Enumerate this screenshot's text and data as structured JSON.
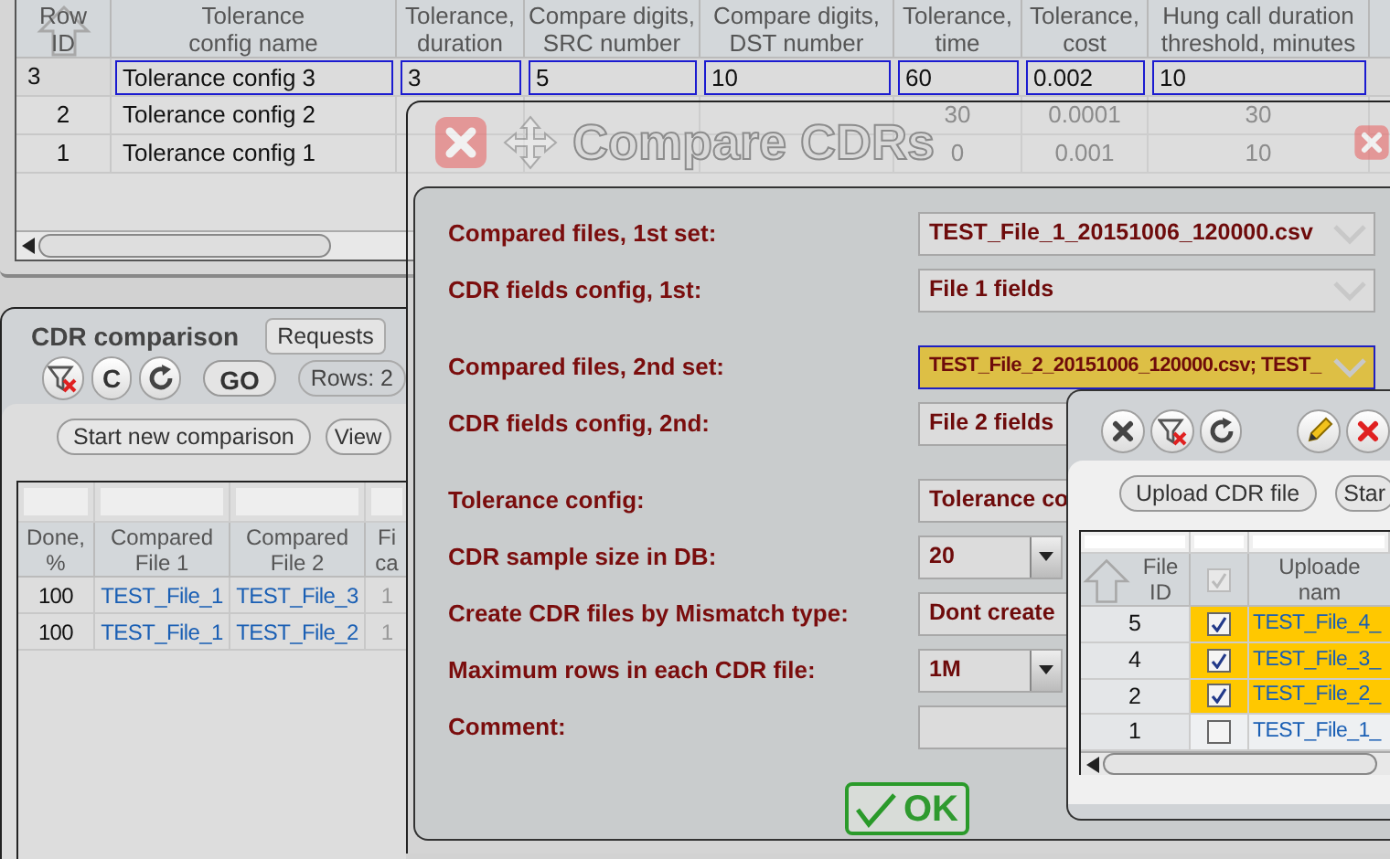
{
  "config_grid": {
    "columns": [
      {
        "label": "Row\nID",
        "sorted": true
      },
      {
        "label": "Tolerance\nconfig name",
        "sorted": false
      },
      {
        "label": "Tolerance,\nduration",
        "sorted": false
      },
      {
        "label": "Compare digits,\nSRC number",
        "sorted": false
      },
      {
        "label": "Compare digits,\nDST number",
        "sorted": false
      },
      {
        "label": "Tolerance,\ntime",
        "sorted": false
      },
      {
        "label": "Tolerance,\ncost",
        "sorted": false
      },
      {
        "label": "Hung call duration\nthreshold, minutes",
        "sorted": false
      }
    ],
    "rows": [
      {
        "selected": true,
        "row_id": "3",
        "name": "Tolerance config 3",
        "duration": "3",
        "src": "5",
        "dst": "10",
        "time": "60",
        "cost": "0.002",
        "hung": "10"
      },
      {
        "selected": false,
        "row_id": "2",
        "name": "Tolerance config 2",
        "time": "30",
        "cost": "0.0001",
        "hung": "30"
      },
      {
        "selected": false,
        "row_id": "1",
        "name": "Tolerance config 1",
        "time": "0",
        "cost": "0.001",
        "hung": "10"
      }
    ]
  },
  "cdr_comparison": {
    "title": "CDR comparison",
    "requests_button": "Requests",
    "toolbar": [
      "C",
      "GO"
    ],
    "rows_count": "Rows: 2",
    "buttons": [
      "Start new comparison",
      "View"
    ],
    "columns": [
      "Done,\n%",
      "Compared\nFile 1",
      "Compared\nFile 2",
      "Fi\nca"
    ],
    "rows": [
      [
        "100",
        "TEST_File_1",
        "TEST_File_3",
        "1"
      ],
      [
        "100",
        "TEST_File_1",
        "TEST_File_2",
        "1"
      ]
    ]
  },
  "dialog": {
    "title": "Compare CDRs",
    "sections": [
      [
        {
          "label": "Compared files, 1st set:",
          "value": "TEST_File_1_20151006_120000.csv",
          "kind": "combo",
          "focused": false
        },
        {
          "label": "CDR fields config, 1st:",
          "value": "File 1 fields",
          "kind": "combo",
          "focused": false
        }
      ],
      [
        {
          "label": "Compared files, 2nd set:",
          "value": "TEST_File_2_20151006_120000.csv; TEST_",
          "kind": "combo",
          "focused": true
        },
        {
          "label": "CDR fields config, 2nd:",
          "value": "File 2 fields",
          "kind": "combo",
          "focused": false
        }
      ],
      [
        {
          "label": "Tolerance config:",
          "value": "Tolerance co",
          "kind": "combo",
          "focused": false
        },
        {
          "label": "CDR sample size in DB:",
          "value": "20",
          "kind": "select",
          "focused": false
        },
        {
          "label": "Create CDR files by Mismatch type:",
          "value": "Dont create",
          "kind": "combo",
          "focused": false
        },
        {
          "label": "Maximum rows in each CDR file:",
          "value": "1M",
          "kind": "select",
          "focused": false
        },
        {
          "label": "Comment:",
          "kind": "text",
          "focused": false
        }
      ]
    ],
    "ok_button": "OK"
  },
  "file_list": {
    "buttons": [
      "Upload CDR file",
      "Star"
    ],
    "columns": [
      "File\nID",
      "Uploade\nnam"
    ],
    "header_checkbox": {
      "checked": true,
      "disabled": true
    },
    "rows": [
      {
        "file_id": "5",
        "checked": true,
        "name": "TEST_File_4_"
      },
      {
        "file_id": "4",
        "checked": true,
        "name": "TEST_File_3_"
      },
      {
        "file_id": "2",
        "checked": true,
        "name": "TEST_File_2_"
      },
      {
        "file_id": "1",
        "checked": false,
        "name": "TEST_File_1_"
      }
    ]
  }
}
